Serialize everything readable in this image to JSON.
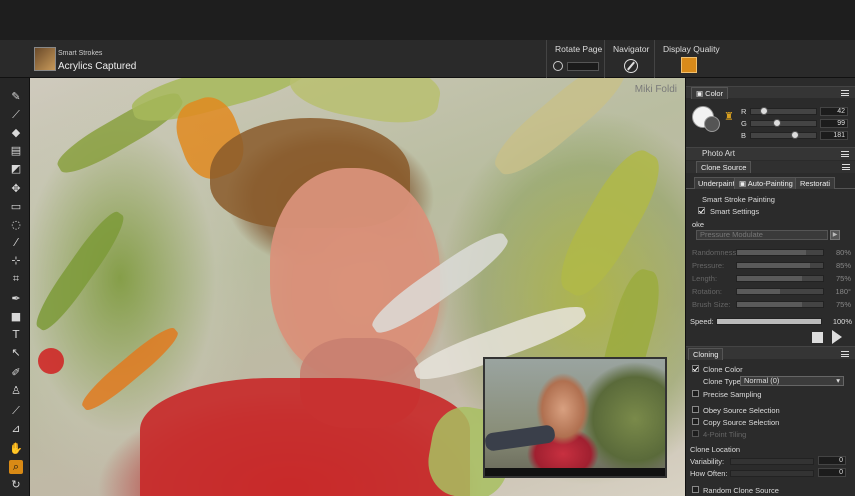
{
  "toolbar": {
    "brush_category": "Smart Strokes",
    "brush_variant": "Acrylics Captured",
    "rotate_label": "Rotate Page",
    "navigator_label": "Navigator",
    "display_quality_label": "Display Quality"
  },
  "tools": [
    {
      "icon": "brush-icon",
      "glyph": "✎"
    },
    {
      "icon": "dropper-icon",
      "glyph": "⟋"
    },
    {
      "icon": "paint-bucket-icon",
      "glyph": "◆"
    },
    {
      "icon": "gradient-icon",
      "glyph": "▤"
    },
    {
      "icon": "eraser-icon",
      "glyph": "◩"
    },
    {
      "icon": "move-icon",
      "glyph": "✥"
    },
    {
      "icon": "rectangle-select-icon",
      "glyph": "▭"
    },
    {
      "icon": "lasso-icon",
      "glyph": "◌"
    },
    {
      "icon": "magic-wand-icon",
      "glyph": "⁄"
    },
    {
      "icon": "transform-icon",
      "glyph": "⊹"
    },
    {
      "icon": "crop-icon",
      "glyph": "⌗"
    },
    {
      "icon": "pen-icon",
      "glyph": "✒"
    },
    {
      "icon": "shape-icon",
      "glyph": "■"
    },
    {
      "icon": "text-icon",
      "glyph": "T"
    },
    {
      "icon": "direct-select-icon",
      "glyph": "↖"
    },
    {
      "icon": "cloner-icon",
      "glyph": "✐"
    },
    {
      "icon": "rubber-stamp-icon",
      "glyph": "♙"
    },
    {
      "icon": "dodge-icon",
      "glyph": "⟋"
    },
    {
      "icon": "mirror-icon",
      "glyph": "⊿"
    },
    {
      "icon": "grabber-icon",
      "glyph": "✋"
    },
    {
      "icon": "magnifier-icon",
      "glyph": "⌕"
    },
    {
      "icon": "rotate-page-icon",
      "glyph": "↻"
    }
  ],
  "canvas": {
    "watermark": "Miki Foldi"
  },
  "color_panel": {
    "title": "Color",
    "r_label": "R",
    "r_value": "42",
    "r_level": 0.16,
    "g_label": "G",
    "g_value": "99",
    "g_level": 0.39,
    "b_label": "B",
    "b_value": "181",
    "b_level": 0.71,
    "main_color": "#f2f2f2",
    "additional_color": "#555555"
  },
  "photo_art": {
    "title": "Photo Art",
    "clone_source_tab": "Clone Source"
  },
  "auto_painting": {
    "tabs": [
      "Underpaint",
      "Auto-Painting",
      "Restorati"
    ],
    "smart_stroke_painting": "Smart Stroke Painting",
    "smart_settings": "Smart Settings",
    "stroke_label": "oke",
    "stroke_value": "Pressure Modulate",
    "rows": [
      {
        "label": "Randomness:",
        "value": "80%",
        "level": 0.8
      },
      {
        "label": "Pressure:",
        "value": "85%",
        "level": 0.85
      },
      {
        "label": "Length:",
        "value": "75%",
        "level": 0.75
      },
      {
        "label": "Rotation:",
        "value": "180°",
        "level": 0.5
      },
      {
        "label": "Brush Size:",
        "value": "75%",
        "level": 0.75
      }
    ],
    "speed_label": "Speed:",
    "speed_value": "100%",
    "speed_level": 1.0
  },
  "cloning": {
    "title": "Cloning",
    "clone_color": "Clone Color",
    "clone_type_label": "Clone Type:",
    "clone_type_value": "Normal (0)",
    "precise_sampling": "Precise Sampling",
    "obey_source_selection": "Obey Source Selection",
    "copy_source_selection": "Copy Source Selection",
    "four_point_tiling": "4-Point Tiling",
    "clone_location": "Clone Location",
    "variability_label": "Variability:",
    "variability_value": "0",
    "how_often_label": "How Often:",
    "how_often_value": "0",
    "random_clone_source": "Random Clone Source"
  }
}
